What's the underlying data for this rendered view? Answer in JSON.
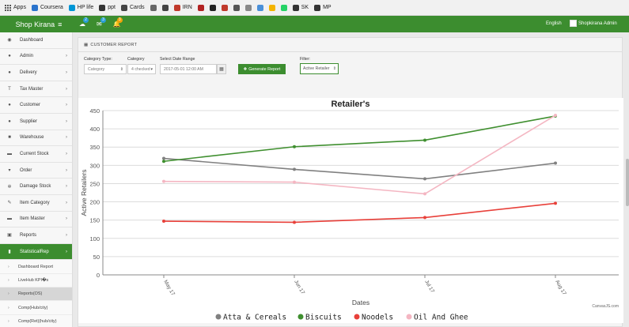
{
  "bookmarks": [
    {
      "label": "Apps",
      "icon": "apps-grid-icon",
      "color": "#555555"
    },
    {
      "label": "Coursera",
      "icon": "coursera-icon",
      "color": "#2a73cc"
    },
    {
      "label": "HP life",
      "icon": "hp-icon",
      "color": "#0096d6"
    },
    {
      "label": "ppt",
      "icon": "ppt-icon",
      "color": "#333333"
    },
    {
      "label": "Cards",
      "icon": "cards-icon",
      "color": "#444444"
    },
    {
      "label": "",
      "icon": "bookmark-icon",
      "color": "#666666"
    },
    {
      "label": "",
      "icon": "bookmark-icon",
      "color": "#444444"
    },
    {
      "label": "IRN",
      "icon": "irn-icon",
      "color": "#c0392b"
    },
    {
      "label": "",
      "icon": "bw-icon",
      "color": "#b22222"
    },
    {
      "label": "",
      "icon": "circle-icon",
      "color": "#222222"
    },
    {
      "label": "",
      "icon": "bookmark-icon",
      "color": "#c0392b"
    },
    {
      "label": "",
      "icon": "bookmark-icon",
      "color": "#555555"
    },
    {
      "label": "",
      "icon": "bookmark-icon",
      "color": "#888888"
    },
    {
      "label": "",
      "icon": "bookmark-icon",
      "color": "#4a90d9"
    },
    {
      "label": "",
      "icon": "drive-icon",
      "color": "#f4b400"
    },
    {
      "label": "",
      "icon": "whatsapp-icon",
      "color": "#25d366"
    },
    {
      "label": "SK",
      "icon": "sk-icon",
      "color": "#333333"
    },
    {
      "label": "MP",
      "icon": "mp-icon",
      "color": "#333333"
    }
  ],
  "navbar": {
    "brand": "Shop Kirana",
    "menu_icon": "≡",
    "icons": [
      {
        "name": "chat-icon",
        "glyph": "☁",
        "count": "2",
        "count_color": "#2a9fd6"
      },
      {
        "name": "mail-icon",
        "glyph": "✉",
        "count": "3",
        "count_color": "#2a9fd6"
      },
      {
        "name": "bell-icon",
        "glyph": "🔔",
        "count": "3",
        "count_color": "#f0a30a"
      }
    ],
    "language": "English",
    "user": "Shopkirana Admin",
    "bg_color": "#3c8d2f"
  },
  "sidebar": {
    "items": [
      {
        "label": "Dashboard",
        "icon": "dashboard-icon",
        "glyph": "◉",
        "chevron": ""
      },
      {
        "label": "Admin",
        "icon": "user-icon",
        "glyph": "●",
        "chevron": "›"
      },
      {
        "label": "Delivery",
        "icon": "user-icon",
        "glyph": "●",
        "chevron": "›"
      },
      {
        "label": "Tax Master",
        "icon": "text-height-icon",
        "glyph": "T",
        "chevron": "›"
      },
      {
        "label": "Customer",
        "icon": "user-icon",
        "glyph": "●",
        "chevron": "›"
      },
      {
        "label": "Supplier",
        "icon": "user-icon",
        "glyph": "●",
        "chevron": "›"
      },
      {
        "label": "Warehouse",
        "icon": "truck-icon",
        "glyph": "■",
        "chevron": "›"
      },
      {
        "label": "Current Stock",
        "icon": "folder-icon",
        "glyph": "▬",
        "chevron": "›"
      },
      {
        "label": "Order",
        "icon": "cart-icon",
        "glyph": "▾",
        "chevron": "›"
      },
      {
        "label": "Damage Stock",
        "icon": "gear-icon",
        "glyph": "✲",
        "chevron": "›"
      },
      {
        "label": "Item Category",
        "icon": "pencil-icon",
        "glyph": "✎",
        "chevron": "›"
      },
      {
        "label": "Item Master",
        "icon": "folder-open-icon",
        "glyph": "▬",
        "chevron": "›"
      },
      {
        "label": "Reports",
        "icon": "briefcase-icon",
        "glyph": "▣",
        "chevron": "›"
      },
      {
        "label": "StatisticalRep",
        "icon": "bar-chart-icon",
        "glyph": "▮",
        "chevron": "›"
      }
    ],
    "sub_items": [
      {
        "label": "Dashboard Report"
      },
      {
        "label": "LiveHub KPI�s"
      },
      {
        "label": "Reports(OS)"
      },
      {
        "label": "Comp(Hub/city)"
      },
      {
        "label": "Comp(Ret)(hub/city)"
      }
    ],
    "active_color": "#3c8d2f"
  },
  "report": {
    "title": "CUSTOMER REPORT",
    "category_type_label": "Category Type:",
    "category_type_value": "Category",
    "category_label": "Category",
    "category_value": "4 checked",
    "date_label": "Select Date Range",
    "date_value": "2017-05-01 12:00 AM",
    "generate_label": "Generate Report",
    "filter_label": "Filter:",
    "filter_value": "Active Retailer"
  },
  "chart_data": {
    "type": "line",
    "title": "Retailer's",
    "xlabel": "Dates",
    "ylabel": "Active Retailers",
    "categories": [
      "May 17",
      "Jun 17",
      "Jul 17",
      "Aug 17"
    ],
    "ylim": [
      0,
      450
    ],
    "yticks": [
      0,
      50,
      100,
      150,
      200,
      250,
      300,
      350,
      400,
      450
    ],
    "grid": true,
    "legend_position": "bottom",
    "series": [
      {
        "name": "Atta & Cereals",
        "color": "#808080",
        "values": [
          319,
          289,
          263,
          306
        ]
      },
      {
        "name": "Biscuits",
        "color": "#3f8f2f",
        "values": [
          311,
          351,
          369,
          435
        ]
      },
      {
        "name": "Noodels",
        "color": "#e8403a",
        "values": [
          147,
          144,
          157,
          196
        ]
      },
      {
        "name": "Oil And Ghee",
        "color": "#f4b6c2",
        "values": [
          256,
          254,
          222,
          437
        ]
      }
    ],
    "credit": "CanvasJS.com"
  }
}
